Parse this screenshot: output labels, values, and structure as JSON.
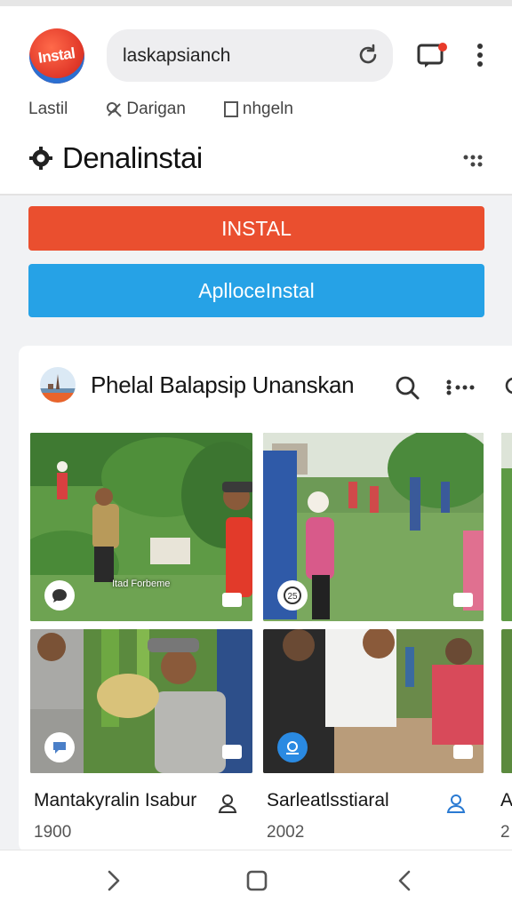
{
  "browser": {
    "logo_text": "Instal",
    "search_value": "laskapsianch",
    "colors": {
      "install": "#ea4f2f",
      "app": "#26a2e6",
      "logo": "#e23a2a"
    }
  },
  "subnav": {
    "items": [
      "Lastil",
      "Darigan",
      "nhgeln"
    ]
  },
  "page": {
    "title": "Denalinstai"
  },
  "buttons": {
    "install": "INSTAL",
    "app": "AplloceInstal"
  },
  "card": {
    "title": "Phelal Balapsip Unanskan",
    "photos": [
      {
        "caption": "Itad Forbeme"
      },
      {
        "caption": ""
      },
      {
        "caption": ""
      },
      {
        "caption": ""
      }
    ],
    "items": [
      {
        "title": "Mantakyralin Isabur",
        "year": "1900"
      },
      {
        "title": "Sarleatlsstiaral",
        "year": "2002"
      },
      {
        "title": "A",
        "year": "2"
      }
    ]
  },
  "icons": [
    "reload-icon",
    "tab-switcher-icon",
    "more-vert-icon",
    "cross-icon",
    "checkbox-icon",
    "gear-icon",
    "more-icon",
    "search-icon",
    "person-icon",
    "chat-icon",
    "back-icon",
    "home-icon",
    "forward-icon"
  ]
}
